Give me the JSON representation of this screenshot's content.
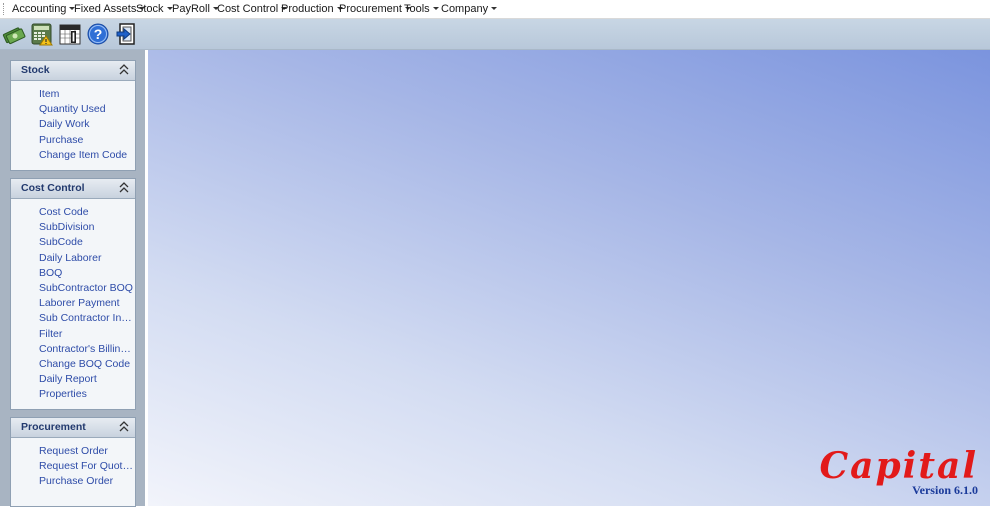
{
  "menu": [
    {
      "label": "Accounting"
    },
    {
      "label": "Fixed Assets"
    },
    {
      "label": "Stock"
    },
    {
      "label": "PayRoll"
    },
    {
      "label": "Cost Control"
    },
    {
      "label": "Production"
    },
    {
      "label": "Procurement"
    },
    {
      "label": "Tools"
    },
    {
      "label": "Company"
    }
  ],
  "toolbar": {
    "icons": [
      "money-icon",
      "calculator-icon",
      "calendar-icon",
      "help-icon",
      "exit-icon"
    ],
    "help_glyph": "?"
  },
  "sidebar": {
    "stock": {
      "title": "Stock",
      "items": [
        "Item",
        "Quantity Used",
        "Daily Work",
        "Purchase",
        "Change Item Code"
      ]
    },
    "cost_control": {
      "title": "Cost Control",
      "items": [
        "Cost Code",
        "SubDivision",
        "SubCode",
        "Daily Laborer",
        "BOQ",
        "SubContractor BOQ",
        "Laborer Payment",
        "Sub Contractor Invoice",
        "Filter",
        "Contractor's Billing Ce...",
        "Change BOQ Code",
        "Daily Report",
        "Properties"
      ]
    },
    "procurement": {
      "title": "Procurement",
      "items": [
        "Request Order",
        "Request For Quotation",
        "Purchase Order"
      ]
    }
  },
  "logo": {
    "word": "Capital",
    "version": "Version 6.1.0"
  },
  "colors": {
    "link": "#2e4ca8",
    "panel_title": "#233a6e",
    "logo_red": "#e21a1a",
    "version_blue": "#1a3a9a"
  }
}
